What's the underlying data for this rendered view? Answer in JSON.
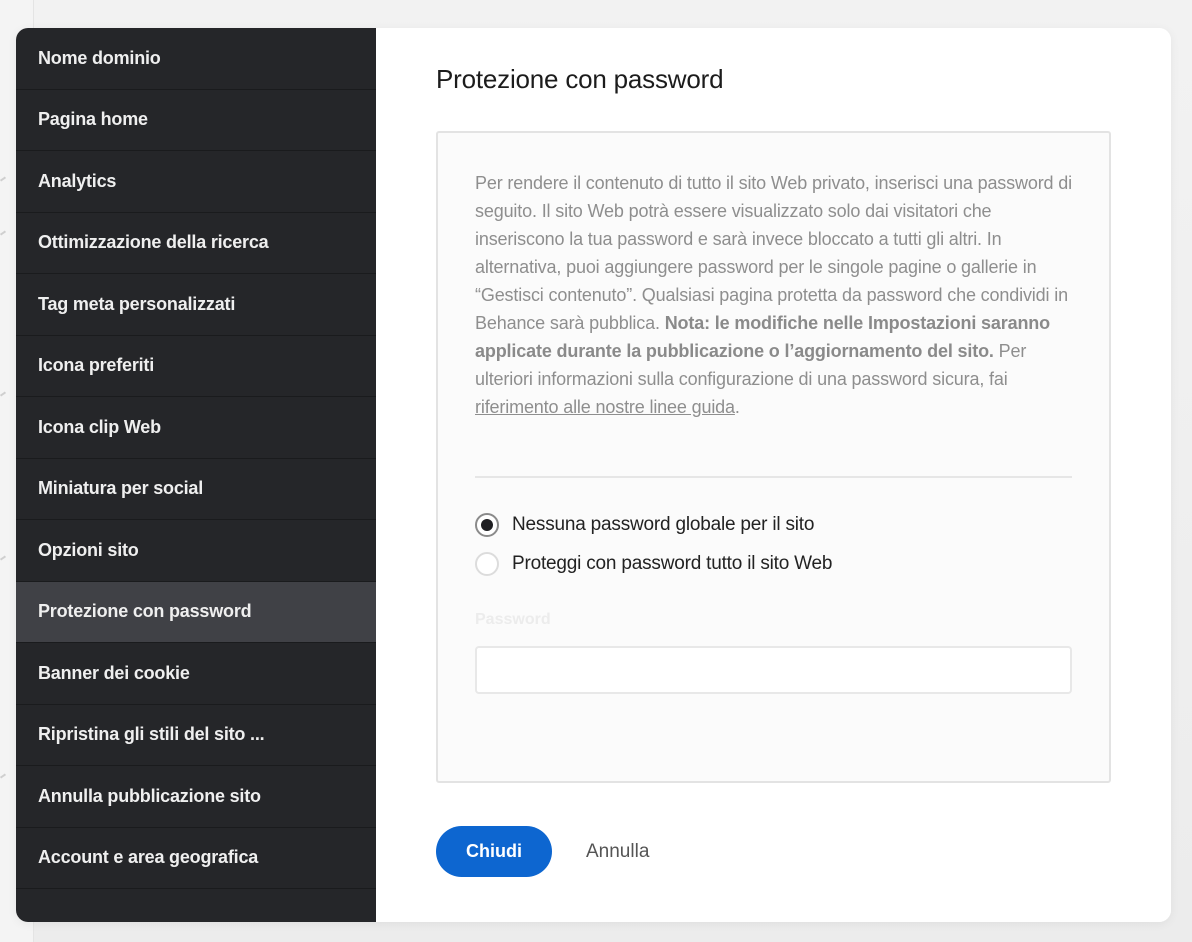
{
  "sidebar": {
    "items": [
      {
        "label": "Nome dominio",
        "active": false
      },
      {
        "label": "Pagina home",
        "active": false
      },
      {
        "label": "Analytics",
        "active": false
      },
      {
        "label": "Ottimizzazione della ricerca",
        "active": false
      },
      {
        "label": "Tag meta personalizzati",
        "active": false
      },
      {
        "label": "Icona preferiti",
        "active": false
      },
      {
        "label": "Icona clip Web",
        "active": false
      },
      {
        "label": "Miniatura per social",
        "active": false
      },
      {
        "label": "Opzioni sito",
        "active": false
      },
      {
        "label": "Protezione con password",
        "active": true
      },
      {
        "label": "Banner dei cookie",
        "active": false
      },
      {
        "label": "Ripristina gli stili del sito ...",
        "active": false
      },
      {
        "label": "Annulla pubblicazione sito",
        "active": false
      },
      {
        "label": "Account e area geografica",
        "active": false
      }
    ]
  },
  "main": {
    "title": "Protezione con password",
    "description": {
      "part1": "Per rendere il contenuto di tutto il sito Web privato, inserisci una password di seguito. Il sito Web potrà essere visualizzato solo dai visitatori che inseriscono la tua password e sarà invece bloccato a tutti gli altri. In alternativa, puoi aggiungere password per le singole pagine o gallerie in “Gestisci contenuto”. Qualsiasi pagina protetta da password che condividi in Behance sarà pubblica. ",
      "bold": "Nota: le modifiche nelle Impostazioni saranno applicate durante la pubblicazione o l’aggiornamento del sito.",
      "part2": " Per ulteriori informazioni sulla configurazione di una password sicura, fai ",
      "link": "riferimento alle nostre linee guida",
      "end": "."
    },
    "options": [
      {
        "label": "Nessuna password globale per il sito",
        "checked": true
      },
      {
        "label": "Proteggi con password tutto il sito Web",
        "checked": false
      }
    ],
    "password": {
      "label": "Password",
      "value": "",
      "placeholder": ""
    },
    "buttons": {
      "close": "Chiudi",
      "cancel": "Annulla"
    }
  },
  "colors": {
    "sidebar_bg": "#252629",
    "sidebar_active": "#404146",
    "primary": "#0d66d0"
  }
}
